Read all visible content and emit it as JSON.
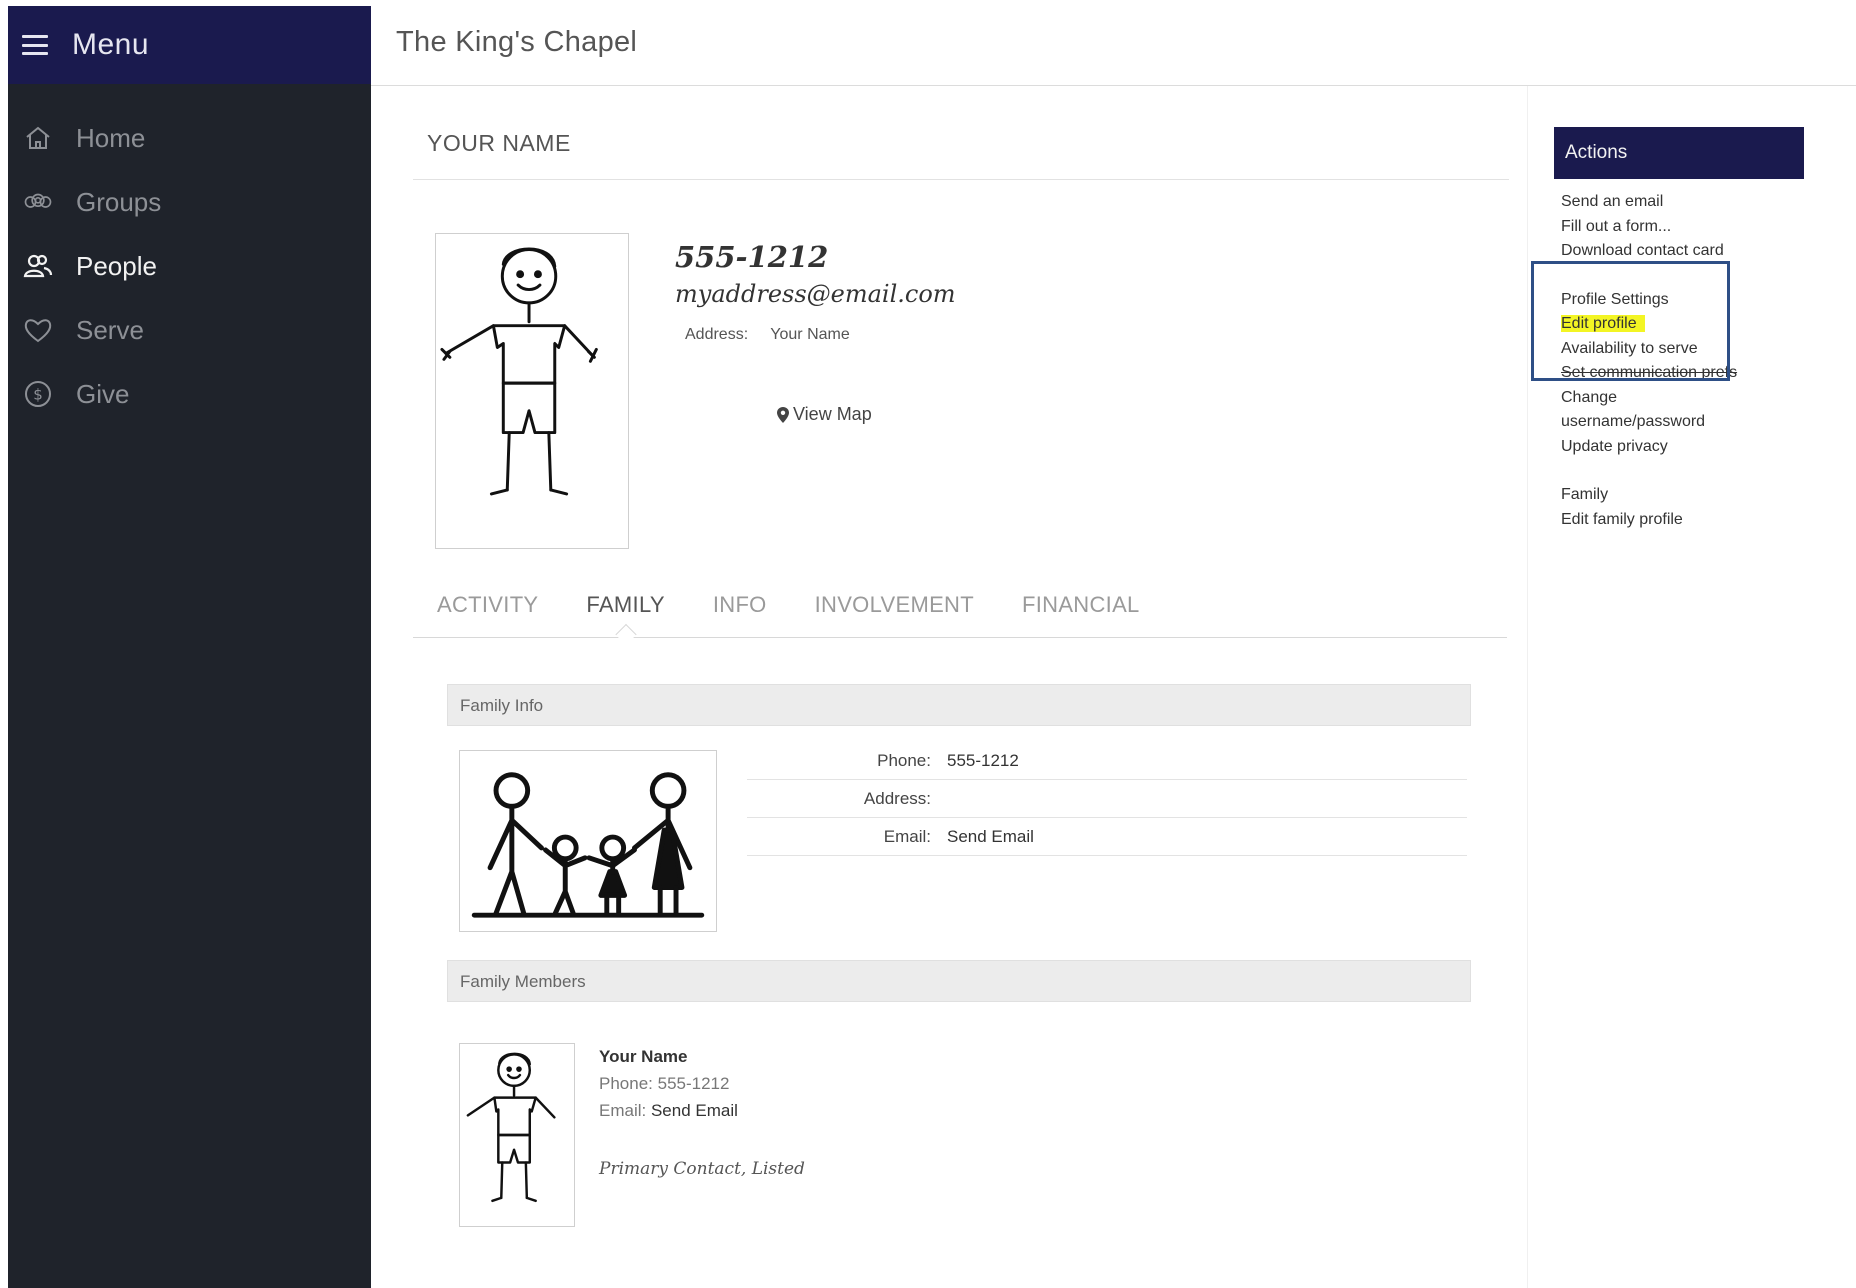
{
  "sidebar": {
    "menu_label": "Menu",
    "items": [
      {
        "label": "Home",
        "icon": "home-icon",
        "active": false
      },
      {
        "label": "Groups",
        "icon": "groups-icon",
        "active": false
      },
      {
        "label": "People",
        "icon": "people-icon",
        "active": true
      },
      {
        "label": "Serve",
        "icon": "heart-icon",
        "active": false
      },
      {
        "label": "Give",
        "icon": "dollar-icon",
        "active": false
      }
    ]
  },
  "header": {
    "site_title": "The King's Chapel"
  },
  "profile": {
    "name": "YOUR NAME",
    "phone": "555-1212",
    "email": "myaddress@email.com",
    "address_label": "Address:",
    "address_value": "Your Name",
    "view_map": "View Map"
  },
  "tabs": [
    {
      "label": "ACTIVITY",
      "active": false
    },
    {
      "label": "FAMILY",
      "active": true
    },
    {
      "label": "INFO",
      "active": false
    },
    {
      "label": "INVOLVEMENT",
      "active": false
    },
    {
      "label": "FINANCIAL",
      "active": false
    }
  ],
  "family_info": {
    "section_title": "Family Info",
    "rows": [
      {
        "label": "Phone:",
        "value": "555-1212"
      },
      {
        "label": "Address:",
        "value": ""
      },
      {
        "label": "Email:",
        "value": "Send Email"
      }
    ]
  },
  "family_members": {
    "section_title": "Family Members",
    "member": {
      "name": "Your Name",
      "phone_label": "Phone:",
      "phone": "555-1212",
      "email_label": "Email:",
      "email": "Send Email",
      "role": "Primary Contact, Listed"
    }
  },
  "actions": {
    "title": "Actions",
    "group1": [
      "Send an email",
      "Fill out a form...",
      "Download contact card"
    ],
    "group2": [
      "Profile Settings",
      "Edit profile",
      "Availability to serve",
      "Set communication prefs",
      "Change",
      "username/password",
      "Update privacy"
    ],
    "group3": [
      "Family",
      "Edit family profile"
    ]
  },
  "colors": {
    "menu_bar": "#1a1a4e",
    "sidebar": "#1f232b",
    "highlight": "#f3f524",
    "focus_box": "#2e4f86"
  }
}
